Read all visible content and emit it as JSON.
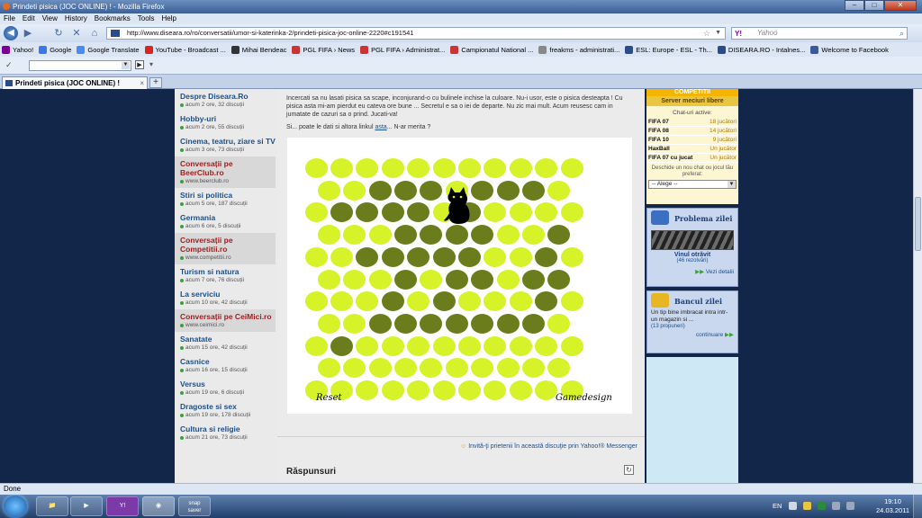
{
  "window": {
    "title": "Prindeti pisica (JOC ONLINE) ! - Mozilla Firefox"
  },
  "menu": [
    "File",
    "Edit",
    "View",
    "History",
    "Bookmarks",
    "Tools",
    "Help"
  ],
  "nav": {
    "url": "http://www.diseara.ro/ro/conversatii/umor-si-katerinka-2/prindeti-pisica-joc-online-2220#c191541",
    "search_placeholder": "Yahoo",
    "search_engine": "Y!"
  },
  "bookmarks": [
    {
      "label": "Yahoo!",
      "color": "#7b0099"
    },
    {
      "label": "Google",
      "color": "#3b78e7"
    },
    {
      "label": "Google Translate",
      "color": "#4a8af4"
    },
    {
      "label": "YouTube - Broadcast ...",
      "color": "#d22"
    },
    {
      "label": "Mihai Bendeac",
      "color": "#333"
    },
    {
      "label": "PGL FIFA › News",
      "color": "#c33"
    },
    {
      "label": "PGL FIFA › Administrat...",
      "color": "#c33"
    },
    {
      "label": "Campionatul National ...",
      "color": "#c33"
    },
    {
      "label": "freakms - administrati...",
      "color": "#888"
    },
    {
      "label": "ESL: Europe - ESL - Th...",
      "color": "#2a4d8a"
    },
    {
      "label": "DISEARA.RO - Intalnes...",
      "color": "#2a4d8a"
    },
    {
      "label": "Welcome to Facebook",
      "color": "#3b5998"
    }
  ],
  "tab": {
    "label": "Prindeti pisica (JOC ONLINE) !"
  },
  "sidebar": [
    {
      "title": "Despre Diseara.Ro",
      "sub": "acum 2 ore, 32 discuții",
      "highlight": false
    },
    {
      "title": "Hobby-uri",
      "sub": "acum 2 ore, 55 discuții",
      "highlight": false
    },
    {
      "title": "Cinema, teatru, ziare si TV",
      "sub": "acum 3 ore, 73 discuții",
      "highlight": false
    },
    {
      "title": "Conversații pe BeerClub.ro",
      "sub": "www.beerclub.ro",
      "highlight": true
    },
    {
      "title": "Stiri si politica",
      "sub": "acum 5 ore, 187 discuții",
      "highlight": false
    },
    {
      "title": "Germania",
      "sub": "acum 6 ore, 5 discuții",
      "highlight": false
    },
    {
      "title": "Conversații pe Competitii.ro",
      "sub": "www.competitii.ro",
      "highlight": true
    },
    {
      "title": "Turism si natura",
      "sub": "acum 7 ore, 76 discuții",
      "highlight": false
    },
    {
      "title": "La serviciu",
      "sub": "acum 10 ore, 42 discuții",
      "highlight": false
    },
    {
      "title": "Conversații pe CeiMici.ro",
      "sub": "www.ceimici.ro",
      "highlight": true
    },
    {
      "title": "Sanatate",
      "sub": "acum 15 ore, 42 discuții",
      "highlight": false
    },
    {
      "title": "Casnice",
      "sub": "acum 16 ore, 15 discuții",
      "highlight": false
    },
    {
      "title": "Versus",
      "sub": "acum 19 ore, 6 discuții",
      "highlight": false
    },
    {
      "title": "Dragoste si sex",
      "sub": "acum 19 ore, 178 discuții",
      "highlight": false
    },
    {
      "title": "Cultura si religie",
      "sub": "acum 21 ore, 73 discuții",
      "highlight": false
    }
  ],
  "main": {
    "intro": "Incercati sa nu lasati pisica sa scape, inconjurand-o cu bulinele inchise la culoare. Nu-i usor, este o pisica desteapta ! Cu pisica asta mi-am pierdut eu cateva ore bune ... Secretul e sa o iei de departe. Nu zic mai mult. Acum reusesc cam in jumatate de cazuri sa o prind. Jucati-va!",
    "intro2_pre": "Si... poate le dati si altora linkul ",
    "intro2_link": "asta",
    "intro2_post": "... N-ar merita ?",
    "game": {
      "reset_label": "Reset",
      "credit_label": "Gamedesign",
      "light_color": "#d6f229",
      "dark_color": "#6b7c1c",
      "board": [
        "LLLLLLLLLLL",
        "LLDDDLDDDLL",
        "LDDDDCDLLLL",
        "LLLDDDDLLDL",
        "LLDDDDDLLDL",
        "LLLDLDDLDDL",
        "LLLDLDLLLDL",
        "LLDDDDDDDLL",
        "LDLLLLLLLLL",
        "LLLLLLLLLLL",
        "LLLLLLLLLLL"
      ]
    },
    "invite": "Invită-ţi prietenii în această discuţie prin Yahoo!® Messenger",
    "replies_label": "Răspunsuri"
  },
  "right": {
    "comp_header": "COMPETITII",
    "servers_label": "Server meciuri libere",
    "chat_label": "Chat-uri active:",
    "chats": [
      {
        "name": "FIFA 07",
        "count": "18 jucători"
      },
      {
        "name": "FIFA 08",
        "count": "14 jucători"
      },
      {
        "name": "FIFA 10",
        "count": "9 jucători"
      },
      {
        "name": "HaxBall",
        "count": "Un jucător"
      },
      {
        "name": "FIFA 07 cu jucat",
        "count": "Un jucător"
      }
    ],
    "chat_desc": "Deschide un nou chat ou jocul tău preferat:",
    "chat_select": "-- Alege --",
    "problem_title": "Problema zilei",
    "problem_name": "Vinul otrăvit",
    "problem_solved": "(46 rezolvări)",
    "problem_details": "Vezi detalii",
    "joke_title": "Bancul zilei",
    "joke_text": "Un tip bine imbracat intra intr-un magazin si ...",
    "joke_props": "(13 propuneri)",
    "joke_more": "continuare"
  },
  "statusbar": {
    "text": "Done"
  },
  "taskbar": {
    "apps": [
      "folder",
      "media",
      "yahoo",
      "firefox",
      "snap saver"
    ],
    "lang": "EN",
    "time": "19:10",
    "date": "24.03.2011"
  }
}
